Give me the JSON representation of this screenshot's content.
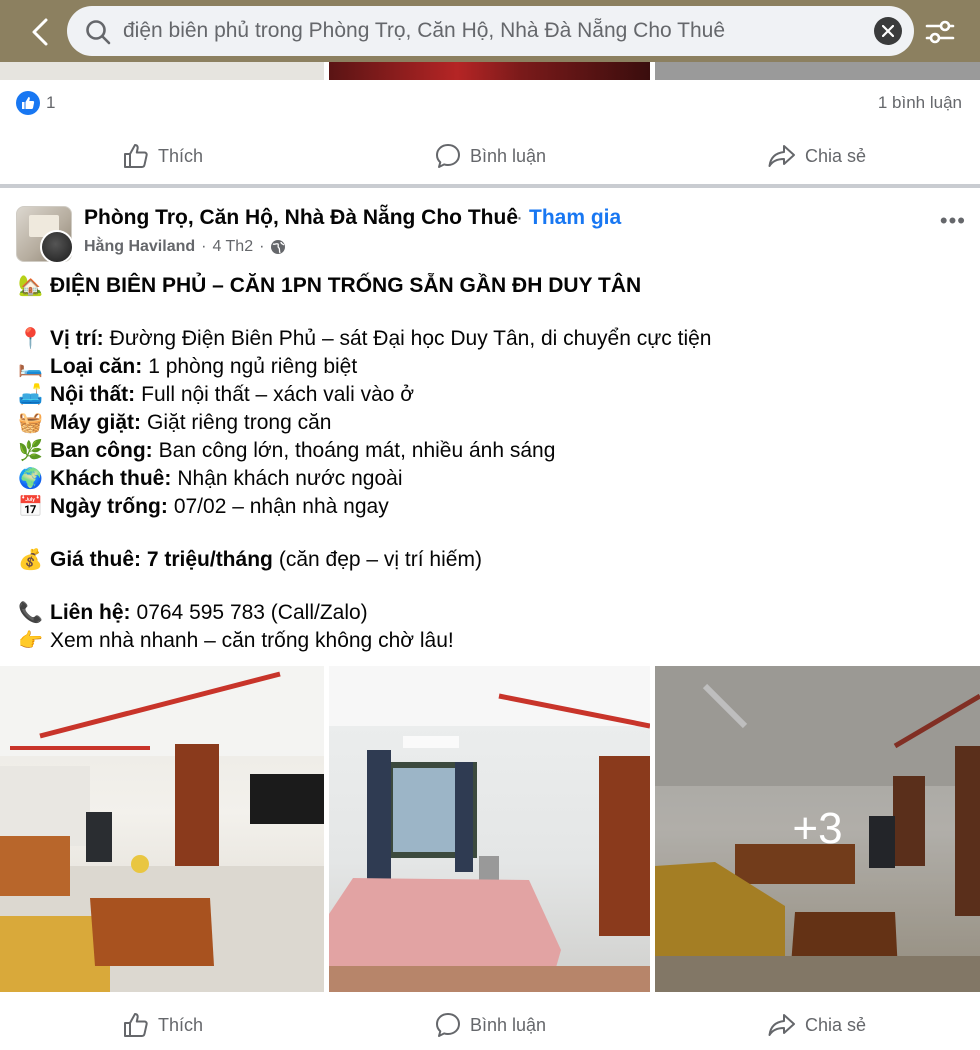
{
  "search": {
    "query": "điện biên phủ trong Phòng Trọ, Căn Hộ, Nhà Đà Nẵng Cho Thuê"
  },
  "prev_post": {
    "like_count": "1",
    "comment_count": "1 bình luận"
  },
  "actions": {
    "like": "Thích",
    "comment": "Bình luận",
    "share": "Chia sẻ"
  },
  "post": {
    "group_name": "Phòng Trọ, Căn Hộ, Nhà Đà Nẵng Cho Thuê",
    "separator": "·",
    "join_label": "Tham gia",
    "author": "Hằng Haviland",
    "time": "4 Th2",
    "meta_dot": "·",
    "title": "ĐIỆN BIÊN PHỦ – CĂN 1PN TRỐNG SẴN GẦN ĐH DUY TÂN",
    "title_emoji": "🏡",
    "details": [
      {
        "emoji": "📍",
        "label": "Vị trí:",
        "value": "Đường Điện Biên Phủ – sát Đại học Duy Tân, di chuyển cực tiện"
      },
      {
        "emoji": "🛏️",
        "label": "Loại căn:",
        "value": "1 phòng ngủ riêng biệt"
      },
      {
        "emoji": "🛋️",
        "label": "Nội thất:",
        "value": "Full nội thất – xách vali vào ở"
      },
      {
        "emoji": "🧺",
        "label": "Máy giặt:",
        "value": "Giặt riêng trong căn"
      },
      {
        "emoji": "🌿",
        "label": "Ban công:",
        "value": "Ban công lớn, thoáng mát, nhiều ánh sáng"
      },
      {
        "emoji": "🌍",
        "label": "Khách thuê:",
        "value": "Nhận khách nước ngoài"
      },
      {
        "emoji": "📅",
        "label": "Ngày trống:",
        "value": "07/02 – nhận nhà ngay"
      }
    ],
    "price": {
      "emoji": "💰",
      "label": "Giá thuê: 7 triệu/tháng",
      "value": "(căn đẹp – vị trí hiếm)"
    },
    "contact": {
      "emoji": "📞",
      "label": "Liên hệ:",
      "value": "0764 595 783 (Call/Zalo)"
    },
    "cta": {
      "emoji": "👉",
      "value": "Xem nhà nhanh – căn trống không chờ lâu!"
    },
    "more_photos": "+3"
  },
  "colors": {
    "accent": "#1877f2",
    "topbar": "#8c8060",
    "muted": "#65676b"
  }
}
